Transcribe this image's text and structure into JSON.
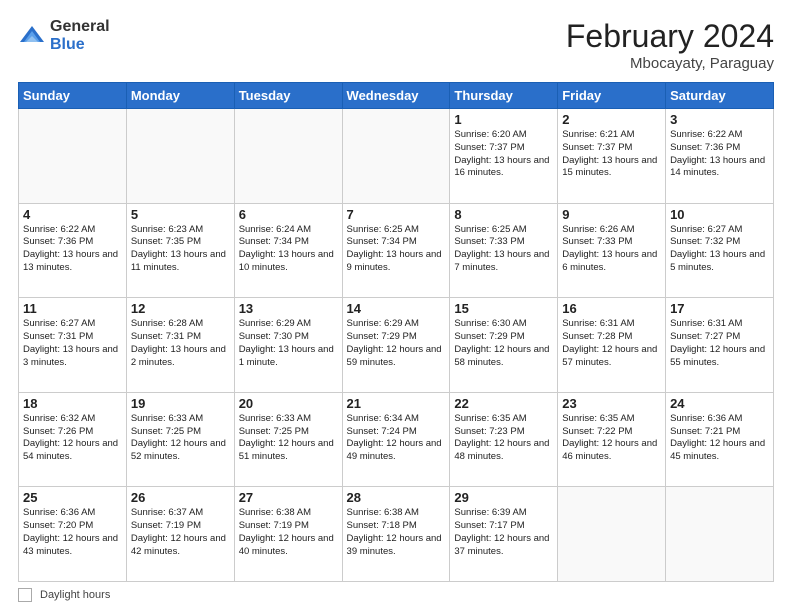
{
  "header": {
    "logo_general": "General",
    "logo_blue": "Blue",
    "title": "February 2024",
    "location": "Mbocayaty, Paraguay"
  },
  "days_of_week": [
    "Sunday",
    "Monday",
    "Tuesday",
    "Wednesday",
    "Thursday",
    "Friday",
    "Saturday"
  ],
  "weeks": [
    [
      {
        "day": "",
        "info": ""
      },
      {
        "day": "",
        "info": ""
      },
      {
        "day": "",
        "info": ""
      },
      {
        "day": "",
        "info": ""
      },
      {
        "day": "1",
        "info": "Sunrise: 6:20 AM\nSunset: 7:37 PM\nDaylight: 13 hours\nand 16 minutes."
      },
      {
        "day": "2",
        "info": "Sunrise: 6:21 AM\nSunset: 7:37 PM\nDaylight: 13 hours\nand 15 minutes."
      },
      {
        "day": "3",
        "info": "Sunrise: 6:22 AM\nSunset: 7:36 PM\nDaylight: 13 hours\nand 14 minutes."
      }
    ],
    [
      {
        "day": "4",
        "info": "Sunrise: 6:22 AM\nSunset: 7:36 PM\nDaylight: 13 hours\nand 13 minutes."
      },
      {
        "day": "5",
        "info": "Sunrise: 6:23 AM\nSunset: 7:35 PM\nDaylight: 13 hours\nand 11 minutes."
      },
      {
        "day": "6",
        "info": "Sunrise: 6:24 AM\nSunset: 7:34 PM\nDaylight: 13 hours\nand 10 minutes."
      },
      {
        "day": "7",
        "info": "Sunrise: 6:25 AM\nSunset: 7:34 PM\nDaylight: 13 hours\nand 9 minutes."
      },
      {
        "day": "8",
        "info": "Sunrise: 6:25 AM\nSunset: 7:33 PM\nDaylight: 13 hours\nand 7 minutes."
      },
      {
        "day": "9",
        "info": "Sunrise: 6:26 AM\nSunset: 7:33 PM\nDaylight: 13 hours\nand 6 minutes."
      },
      {
        "day": "10",
        "info": "Sunrise: 6:27 AM\nSunset: 7:32 PM\nDaylight: 13 hours\nand 5 minutes."
      }
    ],
    [
      {
        "day": "11",
        "info": "Sunrise: 6:27 AM\nSunset: 7:31 PM\nDaylight: 13 hours\nand 3 minutes."
      },
      {
        "day": "12",
        "info": "Sunrise: 6:28 AM\nSunset: 7:31 PM\nDaylight: 13 hours\nand 2 minutes."
      },
      {
        "day": "13",
        "info": "Sunrise: 6:29 AM\nSunset: 7:30 PM\nDaylight: 13 hours\nand 1 minute."
      },
      {
        "day": "14",
        "info": "Sunrise: 6:29 AM\nSunset: 7:29 PM\nDaylight: 12 hours\nand 59 minutes."
      },
      {
        "day": "15",
        "info": "Sunrise: 6:30 AM\nSunset: 7:29 PM\nDaylight: 12 hours\nand 58 minutes."
      },
      {
        "day": "16",
        "info": "Sunrise: 6:31 AM\nSunset: 7:28 PM\nDaylight: 12 hours\nand 57 minutes."
      },
      {
        "day": "17",
        "info": "Sunrise: 6:31 AM\nSunset: 7:27 PM\nDaylight: 12 hours\nand 55 minutes."
      }
    ],
    [
      {
        "day": "18",
        "info": "Sunrise: 6:32 AM\nSunset: 7:26 PM\nDaylight: 12 hours\nand 54 minutes."
      },
      {
        "day": "19",
        "info": "Sunrise: 6:33 AM\nSunset: 7:25 PM\nDaylight: 12 hours\nand 52 minutes."
      },
      {
        "day": "20",
        "info": "Sunrise: 6:33 AM\nSunset: 7:25 PM\nDaylight: 12 hours\nand 51 minutes."
      },
      {
        "day": "21",
        "info": "Sunrise: 6:34 AM\nSunset: 7:24 PM\nDaylight: 12 hours\nand 49 minutes."
      },
      {
        "day": "22",
        "info": "Sunrise: 6:35 AM\nSunset: 7:23 PM\nDaylight: 12 hours\nand 48 minutes."
      },
      {
        "day": "23",
        "info": "Sunrise: 6:35 AM\nSunset: 7:22 PM\nDaylight: 12 hours\nand 46 minutes."
      },
      {
        "day": "24",
        "info": "Sunrise: 6:36 AM\nSunset: 7:21 PM\nDaylight: 12 hours\nand 45 minutes."
      }
    ],
    [
      {
        "day": "25",
        "info": "Sunrise: 6:36 AM\nSunset: 7:20 PM\nDaylight: 12 hours\nand 43 minutes."
      },
      {
        "day": "26",
        "info": "Sunrise: 6:37 AM\nSunset: 7:19 PM\nDaylight: 12 hours\nand 42 minutes."
      },
      {
        "day": "27",
        "info": "Sunrise: 6:38 AM\nSunset: 7:19 PM\nDaylight: 12 hours\nand 40 minutes."
      },
      {
        "day": "28",
        "info": "Sunrise: 6:38 AM\nSunset: 7:18 PM\nDaylight: 12 hours\nand 39 minutes."
      },
      {
        "day": "29",
        "info": "Sunrise: 6:39 AM\nSunset: 7:17 PM\nDaylight: 12 hours\nand 37 minutes."
      },
      {
        "day": "",
        "info": ""
      },
      {
        "day": "",
        "info": ""
      }
    ]
  ],
  "footer": {
    "label": "Daylight hours"
  }
}
